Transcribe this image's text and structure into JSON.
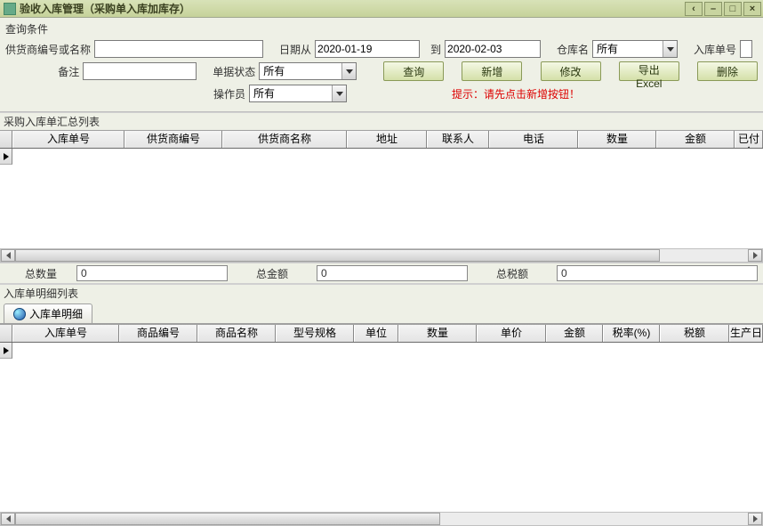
{
  "window": {
    "title": "验收入库管理（采购单入库加库存）"
  },
  "query": {
    "panel_title": "查询条件",
    "supplier_label": "供货商编号或名称",
    "supplier_value": "",
    "date_from_label": "日期从",
    "date_from": "2020-01-19",
    "date_to_label": "到",
    "date_to": "2020-02-03",
    "warehouse_label": "仓库名",
    "warehouse_value": "所有",
    "inbound_no_label": "入库单号",
    "inbound_no_value": "",
    "remark_label": "备注",
    "remark_value": "",
    "status_label": "单据状态",
    "status_value": "所有",
    "operator_label": "操作员",
    "operator_value": "所有",
    "hint": "提示：请先点击新增按钮！",
    "buttons": {
      "search": "查询",
      "add": "新增",
      "edit": "修改",
      "export": "导出Excel",
      "delete": "删除"
    }
  },
  "summary_grid": {
    "title": "采购入库单汇总列表",
    "columns": [
      "入库单号",
      "供货商编号",
      "供货商名称",
      "地址",
      "联系人",
      "电话",
      "数量",
      "金额",
      "已付金"
    ]
  },
  "totals": {
    "qty_label": "总数量",
    "qty_value": "0",
    "amount_label": "总金额",
    "amount_value": "0",
    "tax_label": "总税额",
    "tax_value": "0"
  },
  "detail_grid": {
    "title": "入库单明细列表",
    "tab": "入库单明细",
    "columns": [
      "入库单号",
      "商品编号",
      "商品名称",
      "型号规格",
      "单位",
      "数量",
      "单价",
      "金额",
      "税率(%)",
      "税额",
      "生产日"
    ]
  }
}
